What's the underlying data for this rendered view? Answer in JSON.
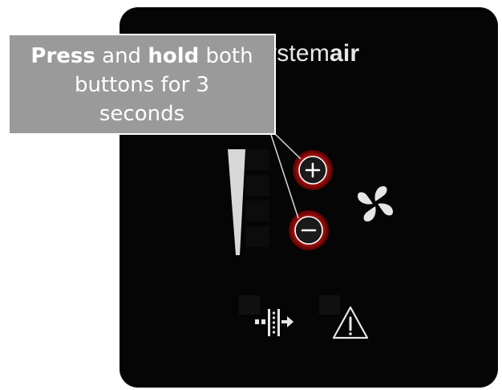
{
  "brand": {
    "prefix": "ystem",
    "suffix": "air"
  },
  "callout": {
    "line1_bold_a": "Press",
    "line1_mid": " and ",
    "line1_bold_b": "hold",
    "line1_end": " both",
    "line2": "buttons for 3",
    "line3": "seconds"
  },
  "icons": {
    "plus": "plus-button-icon",
    "minus": "minus-button-icon",
    "fan": "fan-icon",
    "filter": "filter-icon",
    "warning": "warning-icon",
    "level": "fan-level-indicator"
  },
  "colors": {
    "panel": "#050505",
    "highlight": "#e01818",
    "callout": "#9a9a9a",
    "icon": "#e6e6e6"
  }
}
